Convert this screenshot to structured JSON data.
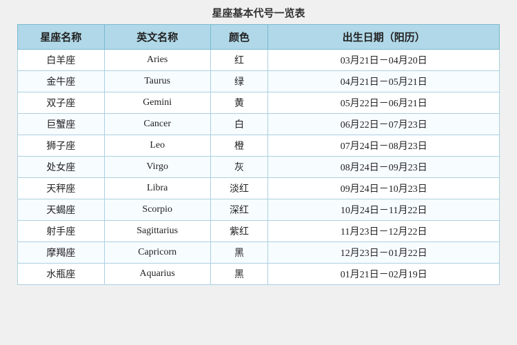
{
  "title": "星座基本代号一览表",
  "table": {
    "headers": [
      "星座名称",
      "英文名称",
      "颜色",
      "出生日期（阳历）"
    ],
    "rows": [
      {
        "cn": "白羊座",
        "en": "Aries",
        "color": "红",
        "date": "03月21日－04月20日"
      },
      {
        "cn": "金牛座",
        "en": "Taurus",
        "color": "绿",
        "date": "04月21日－05月21日"
      },
      {
        "cn": "双子座",
        "en": "Gemini",
        "color": "黄",
        "date": "05月22日－06月21日"
      },
      {
        "cn": "巨蟹座",
        "en": "Cancer",
        "color": "白",
        "date": "06月22日－07月23日"
      },
      {
        "cn": "狮子座",
        "en": "Leo",
        "color": "橙",
        "date": "07月24日－08月23日"
      },
      {
        "cn": "处女座",
        "en": "Virgo",
        "color": "灰",
        "date": "08月24日－09月23日"
      },
      {
        "cn": "天秤座",
        "en": "Libra",
        "color": "淡红",
        "date": "09月24日－10月23日"
      },
      {
        "cn": "天蝎座",
        "en": "Scorpio",
        "color": "深红",
        "date": "10月24日－11月22日"
      },
      {
        "cn": "射手座",
        "en": "Sagittarius",
        "color": "紫红",
        "date": "11月23日－12月22日"
      },
      {
        "cn": "摩羯座",
        "en": "Capricorn",
        "color": "黑",
        "date": "12月23日－01月22日"
      },
      {
        "cn": "水瓶座",
        "en": "Aquarius",
        "color": "黑",
        "date": "01月21日－02月19日"
      }
    ]
  }
}
